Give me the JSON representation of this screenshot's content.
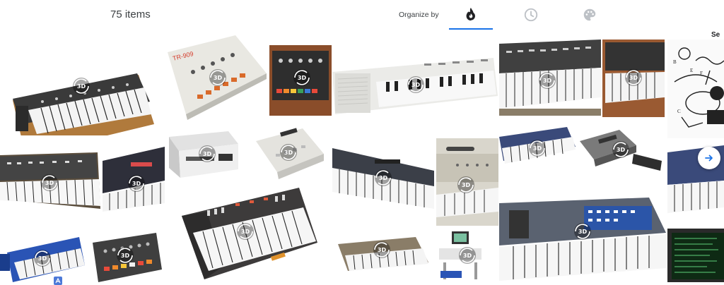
{
  "header": {
    "item_count": "75 items",
    "organize_label": "Organize by",
    "tabs": [
      {
        "icon": "fire-icon",
        "active": true
      },
      {
        "icon": "clock-icon",
        "active": false
      },
      {
        "icon": "palette-icon",
        "active": false
      }
    ]
  },
  "gallery": {
    "badge_label": "3D",
    "side_label": "Se",
    "tiles": [
      {
        "id": "synth-wood-panel",
        "badge": true
      },
      {
        "id": "tr-909",
        "badge": true,
        "label": "TR-909"
      },
      {
        "id": "synth-module-wood",
        "badge": true
      },
      {
        "id": "white-keyboard",
        "badge": true
      },
      {
        "id": "grey-synth-a",
        "badge": true
      },
      {
        "id": "grey-synth-wood",
        "badge": true
      },
      {
        "id": "diagram-drawing",
        "badge": false
      },
      {
        "id": "grey-synth-b",
        "badge": true
      },
      {
        "id": "dark-synth",
        "badge": true
      },
      {
        "id": "rack-unit",
        "badge": true
      },
      {
        "id": "drum-machine-grey",
        "badge": true
      },
      {
        "id": "wide-synth",
        "badge": false
      },
      {
        "id": "keyboard-closeup",
        "badge": true
      },
      {
        "id": "blue-synth",
        "badge": true
      },
      {
        "id": "grey-box",
        "badge": true
      },
      {
        "id": "blue-synth-b",
        "badge": true
      },
      {
        "id": "black-synth-orange",
        "badge": true
      },
      {
        "id": "blue-keytar",
        "badge": true
      },
      {
        "id": "tr-808",
        "badge": true
      },
      {
        "id": "vintage-synth",
        "badge": false
      },
      {
        "id": "computer-station",
        "badge": true
      },
      {
        "id": "large-synth",
        "badge": true
      },
      {
        "id": "blue-synth-c",
        "badge": false
      },
      {
        "id": "green-screen",
        "badge": false
      }
    ]
  },
  "colors": {
    "accent": "#1a73e8",
    "tile_bg": "#f6f6f6"
  }
}
